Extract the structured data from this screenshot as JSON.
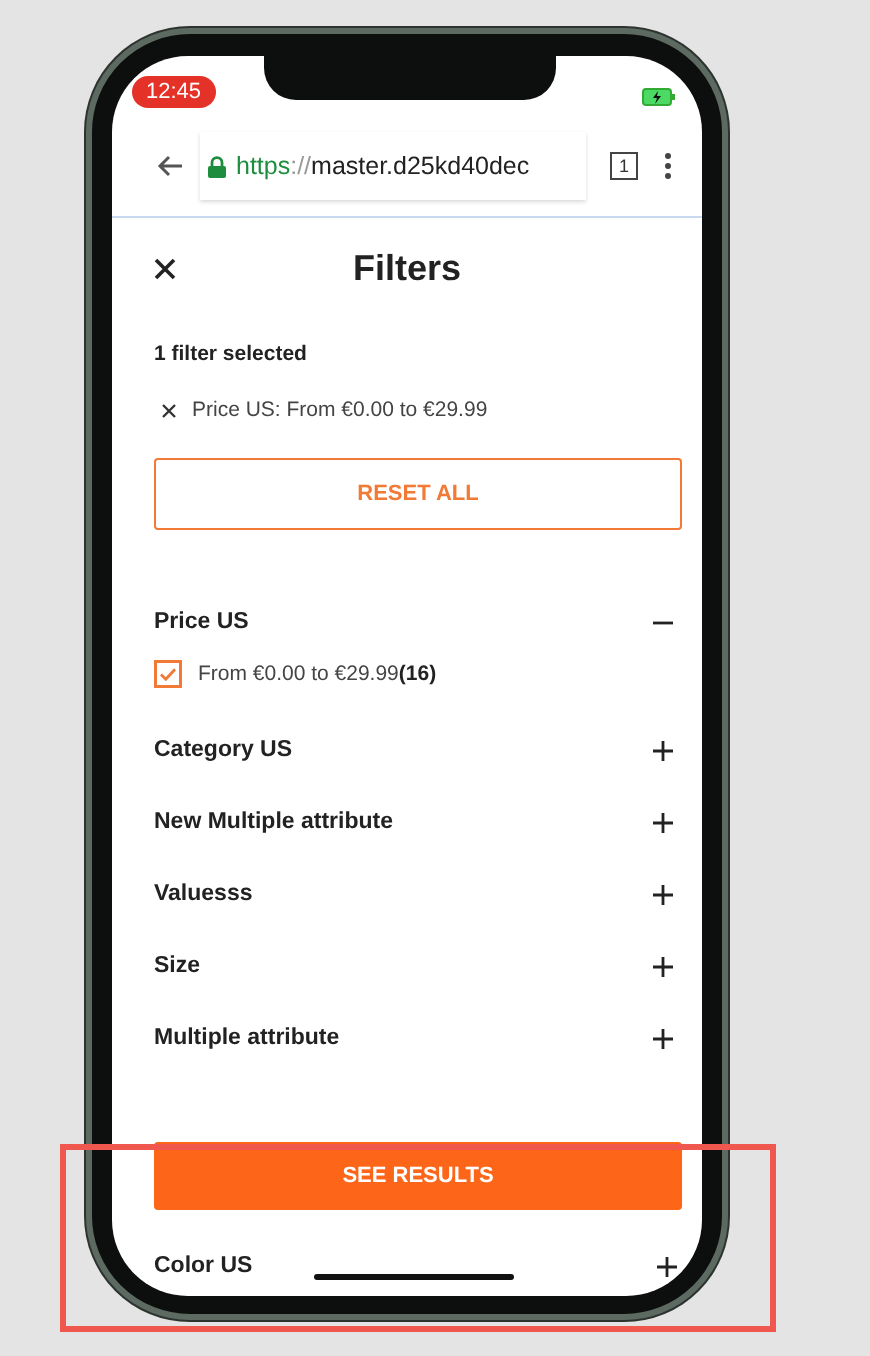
{
  "status_bar": {
    "time": "12:45"
  },
  "browser": {
    "url_scheme": "https",
    "url_separator": "://",
    "url_host": "master.d25kd40dec",
    "tab_count": "1"
  },
  "header": {
    "title": "Filters"
  },
  "selected_filters": {
    "summary": "1 filter selected",
    "chips": [
      {
        "label": "Price US: From €0.00 to €29.99"
      }
    ]
  },
  "reset_button": "RESET ALL",
  "sections": [
    {
      "label": "Price US",
      "expanded": true,
      "options": [
        {
          "label": "From €0.00 to €29.99**(16)**",
          "checked": true
        }
      ]
    },
    {
      "label": "Category US",
      "expanded": false
    },
    {
      "label": "New Multiple attribute",
      "expanded": false
    },
    {
      "label": "Valuesss",
      "expanded": false
    },
    {
      "label": "Size",
      "expanded": false
    },
    {
      "label": "Multiple attribute",
      "expanded": false
    }
  ],
  "results_button": "SEE RESULTS",
  "trailing_sections": [
    {
      "label": "Color US",
      "expanded": false
    }
  ]
}
